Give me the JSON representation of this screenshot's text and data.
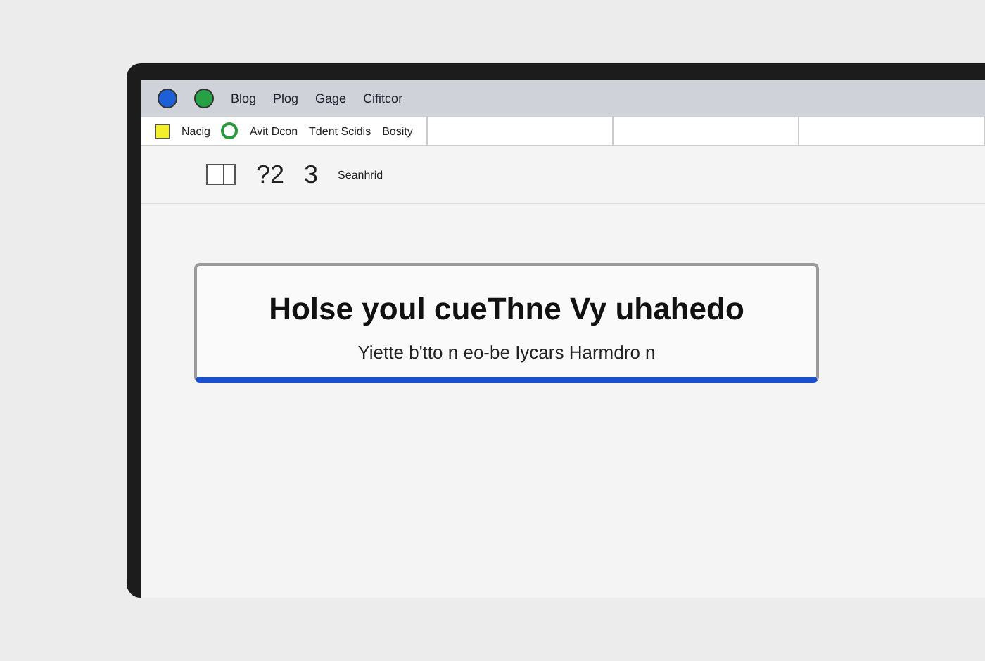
{
  "toolbar": {
    "items": [
      {
        "kind": "icon"
      },
      {
        "kind": "icon"
      },
      {
        "kind": "text",
        "label": "Blog"
      },
      {
        "kind": "text",
        "label": "Plog"
      },
      {
        "kind": "text",
        "label": "Gage"
      },
      {
        "kind": "text",
        "label": "Cifitcor"
      }
    ]
  },
  "ribbon": {
    "items": [
      {
        "label": "Nacig"
      },
      {
        "label": "Avit Dcon"
      },
      {
        "label": "Tdent Scidis"
      },
      {
        "label": "Bosity"
      }
    ]
  },
  "format_bar": {
    "items": [
      "?2",
      "3",
      "Seanhrid"
    ]
  },
  "card": {
    "title": "Holse youl cueThne Vy uhahedo",
    "subtitle": "Yiette b'tto n eo-be Iycars Harmdro n"
  }
}
